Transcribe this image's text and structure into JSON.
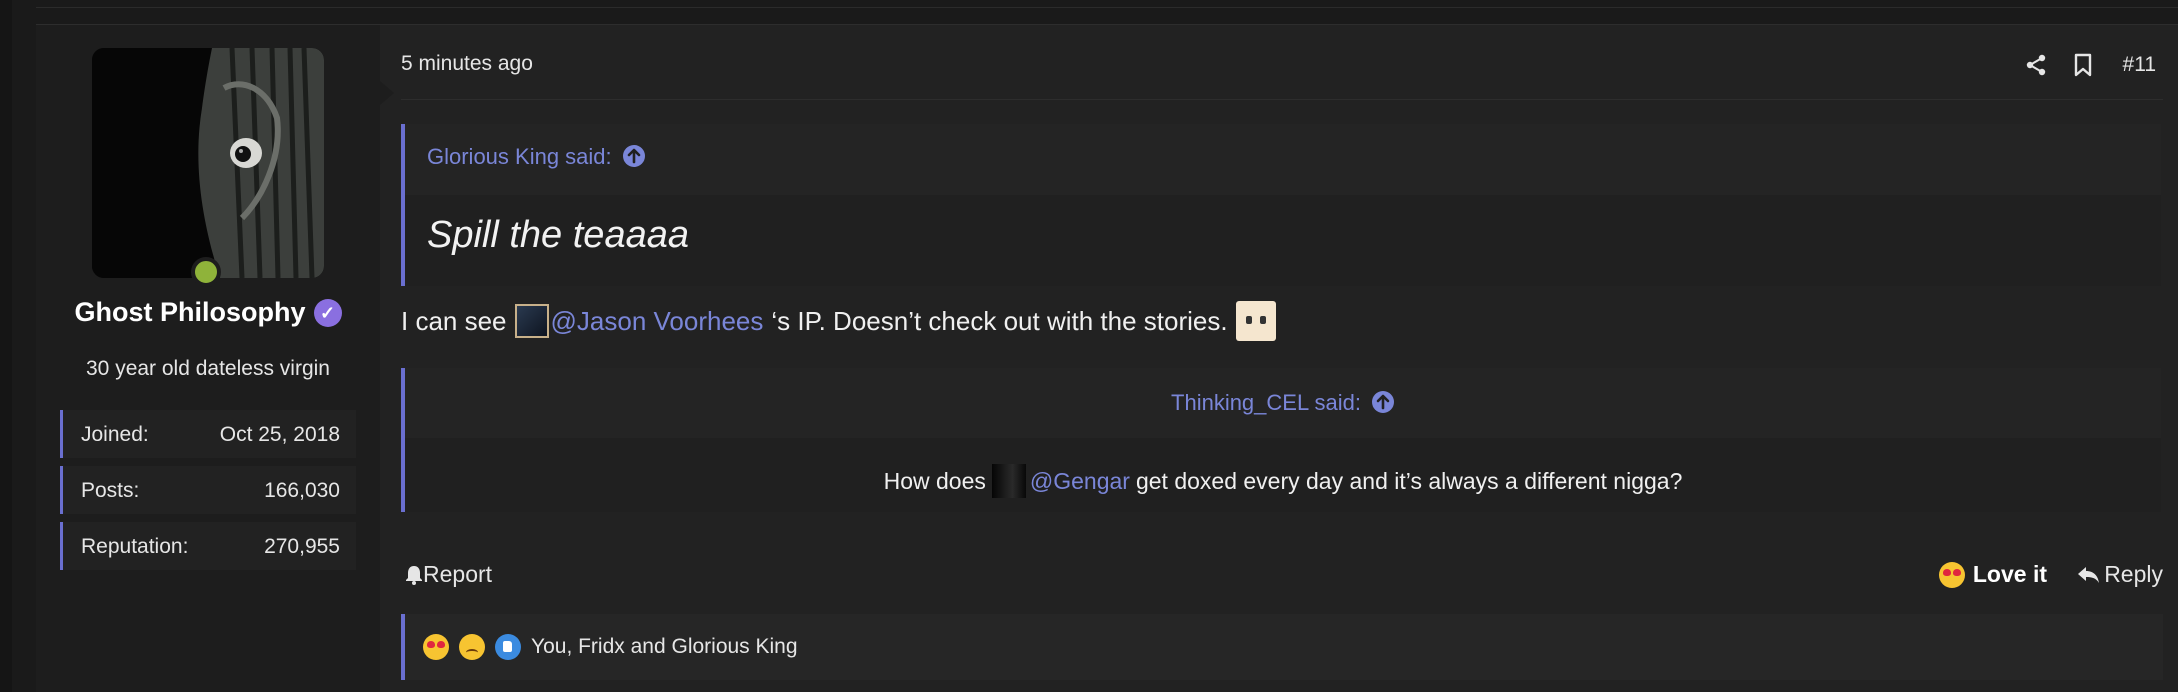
{
  "post": {
    "user": {
      "name": "Ghost Philosophy",
      "title": "30 year old dateless virgin",
      "stats": [
        {
          "label": "Joined:",
          "value": "Oct 25, 2018"
        },
        {
          "label": "Posts:",
          "value": "166,030"
        },
        {
          "label": "Reputation:",
          "value": "270,955"
        }
      ],
      "online_color": "#8fb33a"
    },
    "timestamp": "5 minutes ago",
    "post_number": "#11",
    "header_icons": [
      "share-icon",
      "bookmark-icon"
    ],
    "quote1": {
      "author": "Glorious King said:",
      "text": "Spill the teaaaa"
    },
    "message": {
      "before": "I can see",
      "mention": "@Jason Voorhees",
      "after": "‘s IP. Doesn’t check out with the stories."
    },
    "quote2": {
      "author": "Thinking_CEL said:",
      "before": "How does",
      "mention": "@Gengar",
      "after": "get doxed every day and it’s always a different nigga?"
    },
    "actions": {
      "report": "Report",
      "love": "Love it",
      "reply": "Reply"
    },
    "reactions": {
      "icons": [
        "heart-eyes-emoji",
        "sad-emoji",
        "like-emoji"
      ],
      "names": "You, Fridx and Glorious King"
    },
    "colors": {
      "accent": "#6a6fd0",
      "link": "#7a86d8",
      "background": "#222222",
      "sidebar": "#1d1d1d"
    }
  }
}
